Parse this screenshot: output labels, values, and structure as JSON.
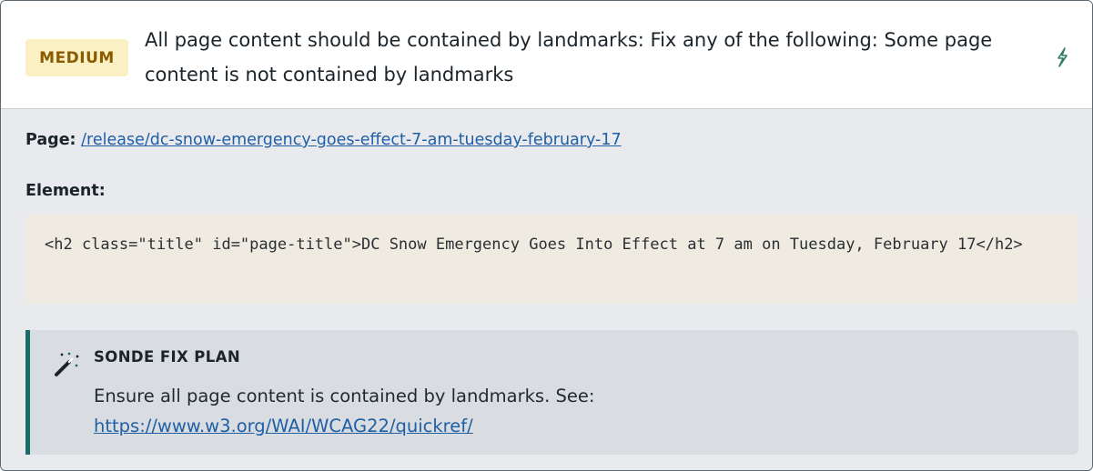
{
  "issue": {
    "severity": "MEDIUM",
    "title": "All page content should be contained by landmarks: Fix any of the following: Some page content is not contained by landmarks",
    "action_icon": "lightning-icon"
  },
  "details": {
    "page_label": "Page:",
    "page_link": "/release/dc-snow-emergency-goes-effect-7-am-tuesday-february-17",
    "element_label": "Element:",
    "element_code": "<h2 class=\"title\" id=\"page-title\">DC Snow Emergency Goes Into Effect at 7 am on Tuesday, February 17</h2>"
  },
  "fix_plan": {
    "icon": "magic-wand-icon",
    "title": "SONDE FIX PLAN",
    "text": "Ensure all page content is contained by landmarks. See:",
    "link": "https://www.w3.org/WAI/WCAG22/quickref/"
  },
  "colors": {
    "badge_bg": "#fbefc4",
    "badge_text": "#8a5a00",
    "link": "#1e5fa5",
    "fix_accent": "#1c6b67"
  }
}
